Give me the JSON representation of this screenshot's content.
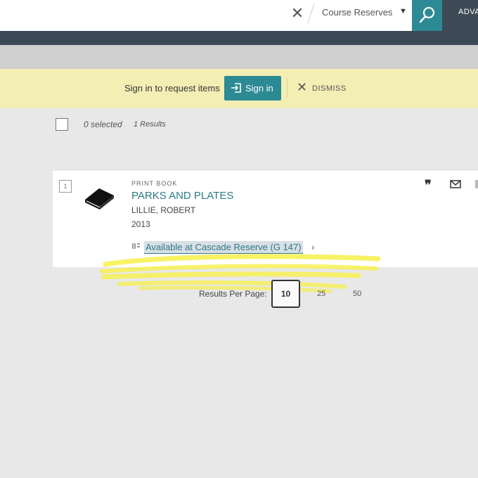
{
  "search": {
    "scope_label": "Course Reserves",
    "advanced_label": "ADVA"
  },
  "banner": {
    "message": "Sign in to request items",
    "signin_label": "Sign in",
    "dismiss_label": "DISMISS"
  },
  "results_header": {
    "selected": "0 selected",
    "results": "1 Results"
  },
  "result": {
    "number": "1",
    "material_type": "PRINT BOOK",
    "title": "PARKS AND PLATES",
    "author": "LILLIE, ROBERT",
    "year": "2013",
    "availability": "Available at Cascade  Reserve (G 147)"
  },
  "pagination": {
    "label": "Results Per Page:",
    "options": [
      "10",
      "25",
      "50"
    ],
    "selected": "10"
  },
  "colors": {
    "brand_teal": "#2c8a94",
    "banner_yellow": "#f3eeb4",
    "highlighter": "#f7f04a"
  }
}
